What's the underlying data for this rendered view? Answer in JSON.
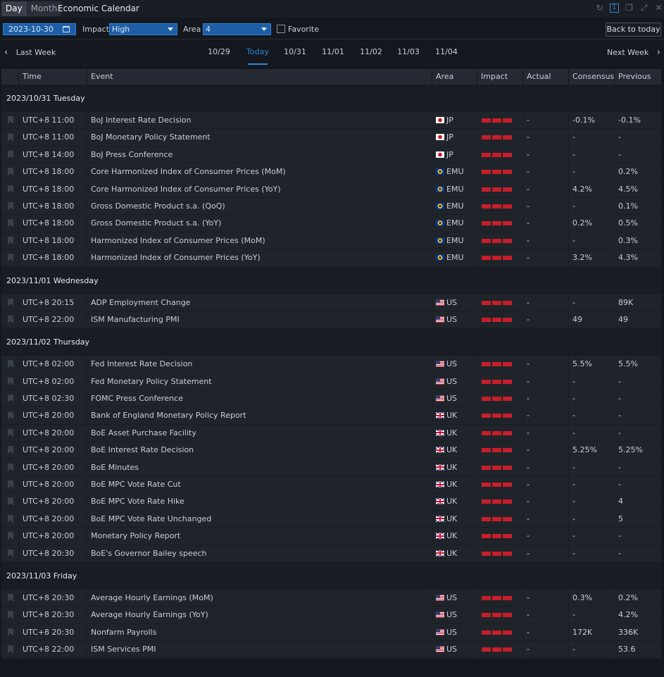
{
  "titlebar": {
    "tabs": [
      {
        "label": "Day",
        "active": true
      },
      {
        "label": "Month",
        "active": false
      }
    ],
    "title": "Economic Calendar",
    "icons": [
      "refresh-icon",
      "pin-icon",
      "restore-icon",
      "expand-icon",
      "close-icon"
    ]
  },
  "filters": {
    "date": "2023-10-30",
    "impact_label": "Impact",
    "impact_value": "High",
    "area_label": "Area",
    "area_value": "4",
    "favorite_label": "Favorite",
    "back_today_label": "Back to today"
  },
  "daynav": {
    "prev_label": "Last Week",
    "next_label": "Next Week",
    "days": [
      "10/29",
      "Today",
      "10/31",
      "11/01",
      "11/02",
      "11/03",
      "11/04"
    ],
    "active_index": 1
  },
  "columns": [
    "Time",
    "Event",
    "Area",
    "Impact",
    "Actual",
    "Consensus",
    "Previous"
  ],
  "colors": {
    "accent": "#2f86d6",
    "impact": "#c81e2a",
    "background": "#14181e"
  },
  "groups": [
    {
      "title": "2023/10/31 Tuesday",
      "rows": [
        {
          "time": "UTC+8 11:00",
          "event": "BoJ Interest Rate Decision",
          "flag": "jp",
          "area": "JP",
          "actual": "-",
          "consensus": "-0.1%",
          "previous": "-0.1%"
        },
        {
          "time": "UTC+8 11:00",
          "event": "BoJ Monetary Policy Statement",
          "flag": "jp",
          "area": "JP",
          "actual": "-",
          "consensus": "-",
          "previous": "-"
        },
        {
          "time": "UTC+8 14:00",
          "event": "BoJ Press Conference",
          "flag": "jp",
          "area": "JP",
          "actual": "-",
          "consensus": "-",
          "previous": "-"
        },
        {
          "time": "UTC+8 18:00",
          "event": "Core Harmonized Index of Consumer Prices (MoM)",
          "flag": "emu",
          "area": "EMU",
          "actual": "-",
          "consensus": "-",
          "previous": "0.2%"
        },
        {
          "time": "UTC+8 18:00",
          "event": "Core Harmonized Index of Consumer Prices (YoY)",
          "flag": "emu",
          "area": "EMU",
          "actual": "-",
          "consensus": "4.2%",
          "previous": "4.5%"
        },
        {
          "time": "UTC+8 18:00",
          "event": "Gross Domestic Product s.a. (QoQ)",
          "flag": "emu",
          "area": "EMU",
          "actual": "-",
          "consensus": "-",
          "previous": "0.1%"
        },
        {
          "time": "UTC+8 18:00",
          "event": "Gross Domestic Product s.a. (YoY)",
          "flag": "emu",
          "area": "EMU",
          "actual": "-",
          "consensus": "0.2%",
          "previous": "0.5%"
        },
        {
          "time": "UTC+8 18:00",
          "event": "Harmonized Index of Consumer Prices (MoM)",
          "flag": "emu",
          "area": "EMU",
          "actual": "-",
          "consensus": "-",
          "previous": "0.3%"
        },
        {
          "time": "UTC+8 18:00",
          "event": "Harmonized Index of Consumer Prices (YoY)",
          "flag": "emu",
          "area": "EMU",
          "actual": "-",
          "consensus": "3.2%",
          "previous": "4.3%"
        }
      ]
    },
    {
      "title": "2023/11/01 Wednesday",
      "rows": [
        {
          "time": "UTC+8 20:15",
          "event": "ADP Employment Change",
          "flag": "us",
          "area": "US",
          "actual": "-",
          "consensus": "-",
          "previous": "89K"
        },
        {
          "time": "UTC+8 22:00",
          "event": "ISM Manufacturing PMI",
          "flag": "us",
          "area": "US",
          "actual": "-",
          "consensus": "49",
          "previous": "49"
        }
      ]
    },
    {
      "title": "2023/11/02 Thursday",
      "rows": [
        {
          "time": "UTC+8 02:00",
          "event": "Fed Interest Rate Decision",
          "flag": "us",
          "area": "US",
          "actual": "-",
          "consensus": "5.5%",
          "previous": "5.5%"
        },
        {
          "time": "UTC+8 02:00",
          "event": "Fed Monetary Policy Statement",
          "flag": "us",
          "area": "US",
          "actual": "-",
          "consensus": "-",
          "previous": "-"
        },
        {
          "time": "UTC+8 02:30",
          "event": "FOMC Press Conference",
          "flag": "us",
          "area": "US",
          "actual": "-",
          "consensus": "-",
          "previous": "-"
        },
        {
          "time": "UTC+8 20:00",
          "event": "Bank of England Monetary Policy Report",
          "flag": "uk",
          "area": "UK",
          "actual": "-",
          "consensus": "-",
          "previous": "-"
        },
        {
          "time": "UTC+8 20:00",
          "event": "BoE Asset Purchase Facility",
          "flag": "uk",
          "area": "UK",
          "actual": "-",
          "consensus": "-",
          "previous": "-"
        },
        {
          "time": "UTC+8 20:00",
          "event": "BoE Interest Rate Decision",
          "flag": "uk",
          "area": "UK",
          "actual": "-",
          "consensus": "5.25%",
          "previous": "5.25%"
        },
        {
          "time": "UTC+8 20:00",
          "event": "BoE Minutes",
          "flag": "uk",
          "area": "UK",
          "actual": "-",
          "consensus": "-",
          "previous": "-"
        },
        {
          "time": "UTC+8 20:00",
          "event": "BoE MPC Vote Rate Cut",
          "flag": "uk",
          "area": "UK",
          "actual": "-",
          "consensus": "-",
          "previous": "-"
        },
        {
          "time": "UTC+8 20:00",
          "event": "BoE MPC Vote Rate Hike",
          "flag": "uk",
          "area": "UK",
          "actual": "-",
          "consensus": "-",
          "previous": "4"
        },
        {
          "time": "UTC+8 20:00",
          "event": "BoE MPC Vote Rate Unchanged",
          "flag": "uk",
          "area": "UK",
          "actual": "-",
          "consensus": "-",
          "previous": "5"
        },
        {
          "time": "UTC+8 20:00",
          "event": "Monetary Policy Report",
          "flag": "uk",
          "area": "UK",
          "actual": "-",
          "consensus": "-",
          "previous": "-"
        },
        {
          "time": "UTC+8 20:30",
          "event": "BoE's Governor Bailey speech",
          "flag": "uk",
          "area": "UK",
          "actual": "-",
          "consensus": "-",
          "previous": "-"
        }
      ]
    },
    {
      "title": "2023/11/03 Friday",
      "rows": [
        {
          "time": "UTC+8 20:30",
          "event": "Average Hourly Earnings (MoM)",
          "flag": "us",
          "area": "US",
          "actual": "-",
          "consensus": "0.3%",
          "previous": "0.2%"
        },
        {
          "time": "UTC+8 20:30",
          "event": "Average Hourly Earnings (YoY)",
          "flag": "us",
          "area": "US",
          "actual": "-",
          "consensus": "-",
          "previous": "4.2%"
        },
        {
          "time": "UTC+8 20:30",
          "event": "Nonfarm Payrolls",
          "flag": "us",
          "area": "US",
          "actual": "-",
          "consensus": "172K",
          "previous": "336K"
        },
        {
          "time": "UTC+8 22:00",
          "event": "ISM Services PMI",
          "flag": "us",
          "area": "US",
          "actual": "-",
          "consensus": "-",
          "previous": "53.6"
        }
      ]
    }
  ]
}
